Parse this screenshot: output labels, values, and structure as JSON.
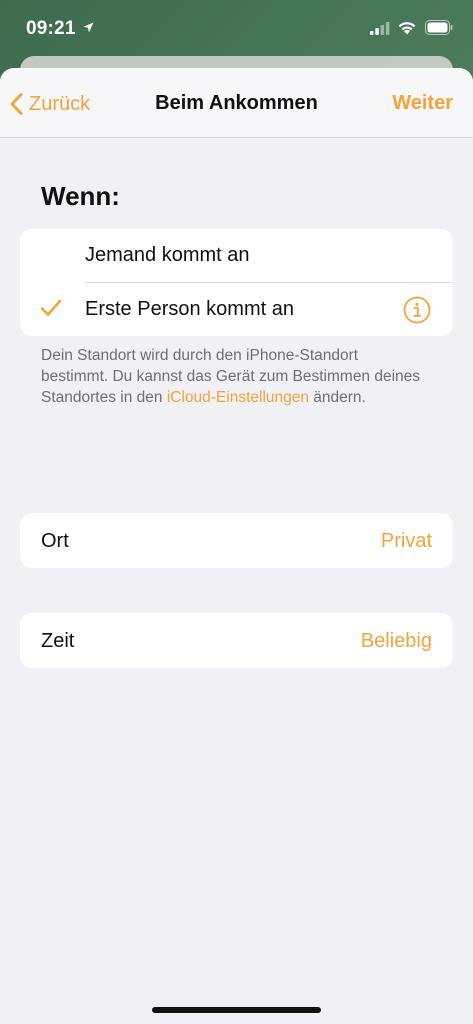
{
  "status": {
    "time": "09:21"
  },
  "nav": {
    "back_label": "Zurück",
    "title": "Beim Ankommen",
    "next_label": "Weiter"
  },
  "section": {
    "header": "Wenn:"
  },
  "options": [
    {
      "label": "Jemand kommt an",
      "selected": false
    },
    {
      "label": "Erste Person kommt an",
      "selected": true
    }
  ],
  "footnote": {
    "text": "Dein Standort wird durch den iPhone-Standort bestimmt. Du kannst das Gerät zum Bestimmen deines Standortes in den ",
    "link": "iCloud-Einstellungen",
    "suffix": " ändern."
  },
  "settings": {
    "place": {
      "label": "Ort",
      "value": "Privat"
    },
    "time": {
      "label": "Zeit",
      "value": "Beliebig"
    }
  },
  "colors": {
    "accent": "#f2a33a",
    "background": "#f1f0f5"
  }
}
